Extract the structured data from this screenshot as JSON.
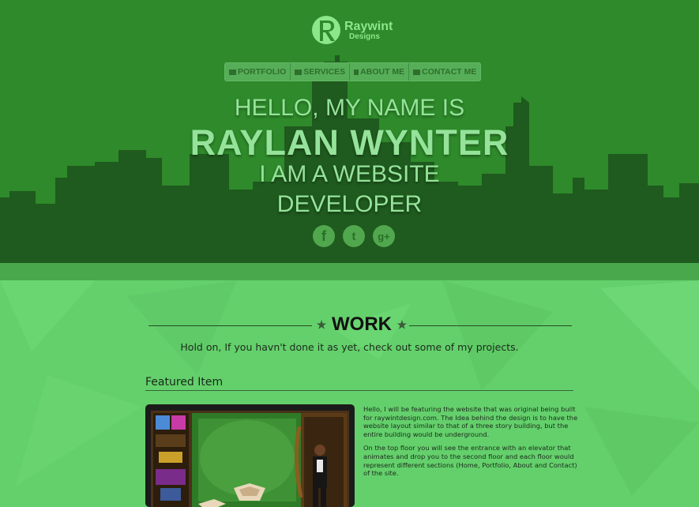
{
  "brand": {
    "name": "Raywint",
    "sub": "Designs"
  },
  "nav": [
    {
      "label": "PORTFOLIO",
      "icon": "folder-icon"
    },
    {
      "label": "SERVICES",
      "icon": "list-icon"
    },
    {
      "label": "ABOUT ME",
      "icon": "user-icon"
    },
    {
      "label": "CONTACT ME",
      "icon": "mail-icon"
    }
  ],
  "hero": {
    "line1": "HELLO, MY NAME IS",
    "line2": "RAYLAN WYNTER",
    "line3": "I AM A WEBSITE",
    "line4": "DEVELOPER"
  },
  "social": [
    {
      "label": "f",
      "icon": "facebook-icon"
    },
    {
      "label": "t",
      "icon": "twitter-icon"
    },
    {
      "label": "g+",
      "icon": "google-plus-icon"
    }
  ],
  "work": {
    "title": "WORK",
    "subtitle": "Hold on, If you havn't done it as yet, check out some of my projects."
  },
  "featured": {
    "title": "Featured Item",
    "paragraph1": "Hello, I will be featuring the website that was original being built for raywintdesign.com. The Idea behind the design is to have the website layout similar to that of a three story building, but the entire building would be underground.",
    "paragraph2": "On the top floor you will see the entrance with an elevator that animates and drop you to the second floor and each floor would represent different sections (Home, Portfolio, About and Contact) of the site."
  },
  "colors": {
    "hero_bg": "#2e8a2a",
    "skyline": "#1f5a1e",
    "content_bg": "#64d06c",
    "text_light": "#95e39a"
  }
}
